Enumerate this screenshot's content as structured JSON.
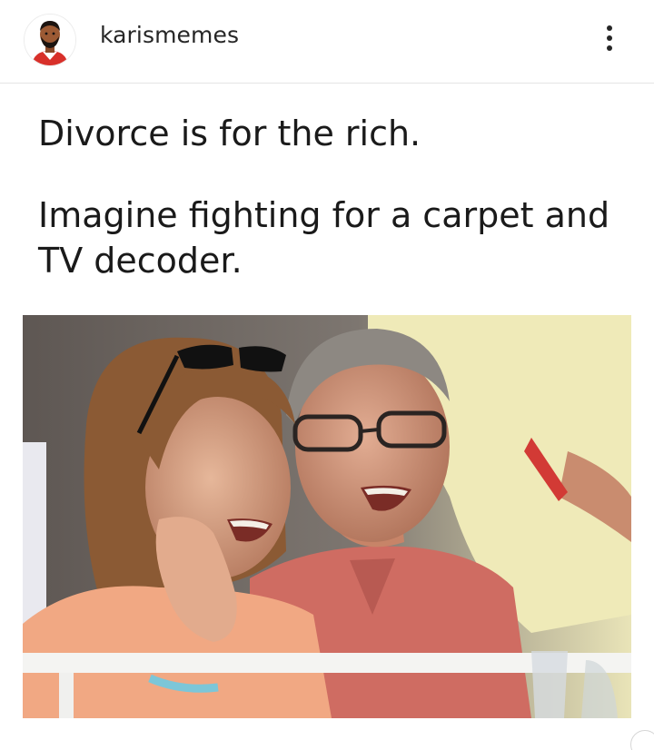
{
  "post": {
    "username": "karismemes",
    "avatar_icon": "cartoon-man-avatar-icon",
    "more_icon": "vertical-ellipsis-icon",
    "caption": {
      "line1": "Divorce is for the rich.",
      "line2": "Imagine fighting for a carpet and",
      "line3": "TV decoder."
    },
    "photo_subject": "laughing-couple-photo"
  },
  "colors": {
    "text": "#1a1a1a",
    "username": "#262626",
    "divider": "#e4e4e4"
  }
}
